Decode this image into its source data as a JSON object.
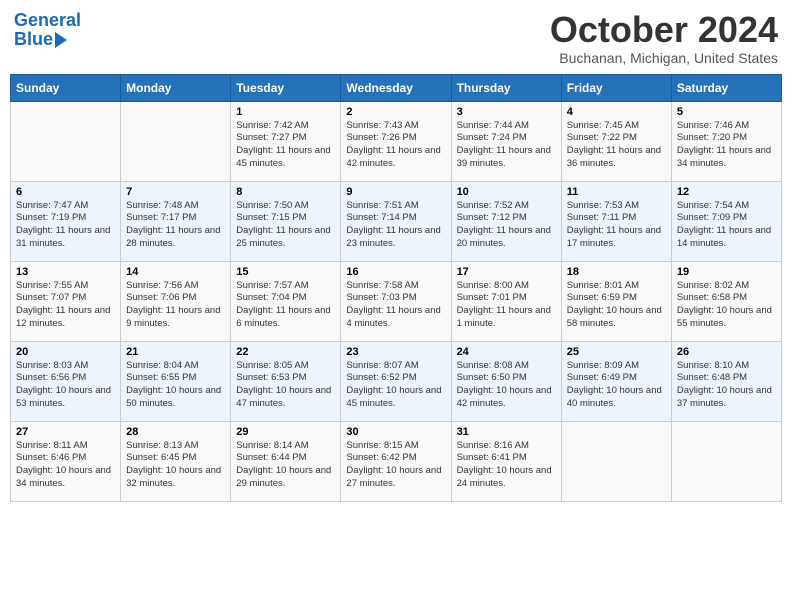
{
  "header": {
    "logo_line1": "General",
    "logo_line2": "Blue",
    "title": "October 2024",
    "location": "Buchanan, Michigan, United States"
  },
  "columns": [
    "Sunday",
    "Monday",
    "Tuesday",
    "Wednesday",
    "Thursday",
    "Friday",
    "Saturday"
  ],
  "weeks": [
    [
      {
        "day": "",
        "info": ""
      },
      {
        "day": "",
        "info": ""
      },
      {
        "day": "1",
        "info": "Sunrise: 7:42 AM\nSunset: 7:27 PM\nDaylight: 11 hours and 45 minutes."
      },
      {
        "day": "2",
        "info": "Sunrise: 7:43 AM\nSunset: 7:26 PM\nDaylight: 11 hours and 42 minutes."
      },
      {
        "day": "3",
        "info": "Sunrise: 7:44 AM\nSunset: 7:24 PM\nDaylight: 11 hours and 39 minutes."
      },
      {
        "day": "4",
        "info": "Sunrise: 7:45 AM\nSunset: 7:22 PM\nDaylight: 11 hours and 36 minutes."
      },
      {
        "day": "5",
        "info": "Sunrise: 7:46 AM\nSunset: 7:20 PM\nDaylight: 11 hours and 34 minutes."
      }
    ],
    [
      {
        "day": "6",
        "info": "Sunrise: 7:47 AM\nSunset: 7:19 PM\nDaylight: 11 hours and 31 minutes."
      },
      {
        "day": "7",
        "info": "Sunrise: 7:48 AM\nSunset: 7:17 PM\nDaylight: 11 hours and 28 minutes."
      },
      {
        "day": "8",
        "info": "Sunrise: 7:50 AM\nSunset: 7:15 PM\nDaylight: 11 hours and 25 minutes."
      },
      {
        "day": "9",
        "info": "Sunrise: 7:51 AM\nSunset: 7:14 PM\nDaylight: 11 hours and 23 minutes."
      },
      {
        "day": "10",
        "info": "Sunrise: 7:52 AM\nSunset: 7:12 PM\nDaylight: 11 hours and 20 minutes."
      },
      {
        "day": "11",
        "info": "Sunrise: 7:53 AM\nSunset: 7:11 PM\nDaylight: 11 hours and 17 minutes."
      },
      {
        "day": "12",
        "info": "Sunrise: 7:54 AM\nSunset: 7:09 PM\nDaylight: 11 hours and 14 minutes."
      }
    ],
    [
      {
        "day": "13",
        "info": "Sunrise: 7:55 AM\nSunset: 7:07 PM\nDaylight: 11 hours and 12 minutes."
      },
      {
        "day": "14",
        "info": "Sunrise: 7:56 AM\nSunset: 7:06 PM\nDaylight: 11 hours and 9 minutes."
      },
      {
        "day": "15",
        "info": "Sunrise: 7:57 AM\nSunset: 7:04 PM\nDaylight: 11 hours and 6 minutes."
      },
      {
        "day": "16",
        "info": "Sunrise: 7:58 AM\nSunset: 7:03 PM\nDaylight: 11 hours and 4 minutes."
      },
      {
        "day": "17",
        "info": "Sunrise: 8:00 AM\nSunset: 7:01 PM\nDaylight: 11 hours and 1 minute."
      },
      {
        "day": "18",
        "info": "Sunrise: 8:01 AM\nSunset: 6:59 PM\nDaylight: 10 hours and 58 minutes."
      },
      {
        "day": "19",
        "info": "Sunrise: 8:02 AM\nSunset: 6:58 PM\nDaylight: 10 hours and 55 minutes."
      }
    ],
    [
      {
        "day": "20",
        "info": "Sunrise: 8:03 AM\nSunset: 6:56 PM\nDaylight: 10 hours and 53 minutes."
      },
      {
        "day": "21",
        "info": "Sunrise: 8:04 AM\nSunset: 6:55 PM\nDaylight: 10 hours and 50 minutes."
      },
      {
        "day": "22",
        "info": "Sunrise: 8:05 AM\nSunset: 6:53 PM\nDaylight: 10 hours and 47 minutes."
      },
      {
        "day": "23",
        "info": "Sunrise: 8:07 AM\nSunset: 6:52 PM\nDaylight: 10 hours and 45 minutes."
      },
      {
        "day": "24",
        "info": "Sunrise: 8:08 AM\nSunset: 6:50 PM\nDaylight: 10 hours and 42 minutes."
      },
      {
        "day": "25",
        "info": "Sunrise: 8:09 AM\nSunset: 6:49 PM\nDaylight: 10 hours and 40 minutes."
      },
      {
        "day": "26",
        "info": "Sunrise: 8:10 AM\nSunset: 6:48 PM\nDaylight: 10 hours and 37 minutes."
      }
    ],
    [
      {
        "day": "27",
        "info": "Sunrise: 8:11 AM\nSunset: 6:46 PM\nDaylight: 10 hours and 34 minutes."
      },
      {
        "day": "28",
        "info": "Sunrise: 8:13 AM\nSunset: 6:45 PM\nDaylight: 10 hours and 32 minutes."
      },
      {
        "day": "29",
        "info": "Sunrise: 8:14 AM\nSunset: 6:44 PM\nDaylight: 10 hours and 29 minutes."
      },
      {
        "day": "30",
        "info": "Sunrise: 8:15 AM\nSunset: 6:42 PM\nDaylight: 10 hours and 27 minutes."
      },
      {
        "day": "31",
        "info": "Sunrise: 8:16 AM\nSunset: 6:41 PM\nDaylight: 10 hours and 24 minutes."
      },
      {
        "day": "",
        "info": ""
      },
      {
        "day": "",
        "info": ""
      }
    ]
  ]
}
